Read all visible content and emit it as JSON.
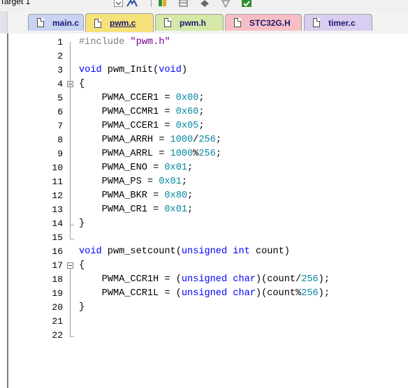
{
  "toolbar": {
    "target": "Target 1"
  },
  "tabs": [
    {
      "label": "main.c",
      "color": "#c9d3f2",
      "active": false
    },
    {
      "label": "pwm.c",
      "color": "#f6e27a",
      "active": true
    },
    {
      "label": "pwm.h",
      "color": "#d6e8a8",
      "active": false
    },
    {
      "label": "STC32G.H",
      "color": "#f7bfc5",
      "active": false
    },
    {
      "label": "timer.c",
      "color": "#d9cdf0",
      "active": false
    }
  ],
  "editor": {
    "lines": [
      {
        "n": "1",
        "tokens": [
          [
            "pp",
            "#include "
          ],
          [
            "str",
            "\"pwm.h\""
          ]
        ]
      },
      {
        "n": "2",
        "tokens": []
      },
      {
        "n": "3",
        "tokens": [
          [
            "kw",
            "void"
          ],
          [
            "",
            " pwm_Init("
          ],
          [
            "kw",
            "void"
          ],
          [
            "",
            ")"
          ]
        ]
      },
      {
        "n": "4",
        "tokens": [
          [
            "",
            "{"
          ]
        ]
      },
      {
        "n": "5",
        "tokens": [
          [
            "",
            "    PWMA_CCER1 = "
          ],
          [
            "num",
            "0x00"
          ],
          [
            "",
            ";"
          ]
        ]
      },
      {
        "n": "6",
        "tokens": [
          [
            "",
            "    PWMA_CCMR1 = "
          ],
          [
            "num",
            "0x60"
          ],
          [
            "",
            ";"
          ]
        ]
      },
      {
        "n": "7",
        "tokens": [
          [
            "",
            "    PWMA_CCER1 = "
          ],
          [
            "num",
            "0x05"
          ],
          [
            "",
            ";"
          ]
        ]
      },
      {
        "n": "8",
        "tokens": [
          [
            "",
            "    PWMA_ARRH = "
          ],
          [
            "num",
            "1000"
          ],
          [
            "",
            "/"
          ],
          [
            "num",
            "256"
          ],
          [
            "",
            ";"
          ]
        ]
      },
      {
        "n": "9",
        "tokens": [
          [
            "",
            "    PWMA_ARRL = "
          ],
          [
            "num",
            "1000"
          ],
          [
            "",
            "%"
          ],
          [
            "num",
            "256"
          ],
          [
            "",
            ";"
          ]
        ]
      },
      {
        "n": "10",
        "tokens": [
          [
            "",
            "    PWMA_ENO = "
          ],
          [
            "num",
            "0x01"
          ],
          [
            "",
            ";"
          ]
        ]
      },
      {
        "n": "11",
        "tokens": [
          [
            "",
            "    PWMA_PS = "
          ],
          [
            "num",
            "0x01"
          ],
          [
            "",
            ";"
          ]
        ]
      },
      {
        "n": "12",
        "tokens": [
          [
            "",
            "    PWMA_BKR = "
          ],
          [
            "num",
            "0x80"
          ],
          [
            "",
            ";"
          ]
        ]
      },
      {
        "n": "13",
        "tokens": [
          [
            "",
            "    PWMA_CR1 = "
          ],
          [
            "num",
            "0x01"
          ],
          [
            "",
            ";"
          ]
        ]
      },
      {
        "n": "14",
        "tokens": [
          [
            "",
            "}"
          ]
        ]
      },
      {
        "n": "15",
        "tokens": []
      },
      {
        "n": "16",
        "tokens": [
          [
            "kw",
            "void"
          ],
          [
            "",
            " pwm_setcount("
          ],
          [
            "kw",
            "unsigned"
          ],
          [
            "",
            " "
          ],
          [
            "kw",
            "int"
          ],
          [
            "",
            " count)"
          ]
        ]
      },
      {
        "n": "17",
        "tokens": [
          [
            "",
            "{"
          ]
        ]
      },
      {
        "n": "18",
        "tokens": [
          [
            "",
            "    PWMA_CCR1H = ("
          ],
          [
            "kw",
            "unsigned"
          ],
          [
            "",
            " "
          ],
          [
            "kw",
            "char"
          ],
          [
            "",
            ")(count/"
          ],
          [
            "num",
            "256"
          ],
          [
            "",
            ");"
          ]
        ]
      },
      {
        "n": "19",
        "tokens": [
          [
            "",
            "    PWMA_CCR1L = ("
          ],
          [
            "kw",
            "unsigned"
          ],
          [
            "",
            " "
          ],
          [
            "kw",
            "char"
          ],
          [
            "",
            ")(count%"
          ],
          [
            "num",
            "256"
          ],
          [
            "",
            ");"
          ]
        ]
      },
      {
        "n": "20",
        "tokens": [
          [
            "",
            "}"
          ]
        ]
      },
      {
        "n": "21",
        "tokens": []
      },
      {
        "n": "22",
        "tokens": []
      }
    ]
  }
}
